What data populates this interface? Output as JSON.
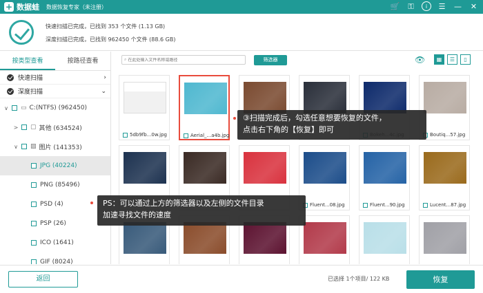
{
  "titlebar": {
    "app_name": "数据蛙",
    "subtitle": "数据恢复专家（未注册）",
    "icons": [
      "cart-icon",
      "key-icon",
      "info-icon",
      "menu-icon",
      "minimize-icon",
      "close-icon"
    ]
  },
  "status": {
    "quick_scan": "快速扫描已完成，已找到 353 个文件 (1.13 GB)",
    "deep_scan": "深度扫描已完成，已找到 962450 个文件 (88.6 GB)"
  },
  "sidebar": {
    "tabs": [
      "按类型查看",
      "按路径查看"
    ],
    "active_tab": 0,
    "quick_scan_label": "快速扫描",
    "deep_scan_label": "深度扫描",
    "tree": [
      {
        "label": "C:(NTFS) (962450)",
        "level": 0,
        "chevron": "∨",
        "icon": "drive-icon"
      },
      {
        "label": "其他 (634524)",
        "level": 1,
        "chevron": ">",
        "icon": "folder-icon"
      },
      {
        "label": "图片 (141353)",
        "level": 1,
        "chevron": "∨",
        "icon": "image-icon"
      },
      {
        "label": "JPG (40224)",
        "level": 2,
        "chevron": "",
        "icon": "",
        "selected": true
      },
      {
        "label": "PNG (85496)",
        "level": 2,
        "chevron": "",
        "icon": ""
      },
      {
        "label": "PSD (4)",
        "level": 2,
        "chevron": "",
        "icon": ""
      },
      {
        "label": "PSP (26)",
        "level": 2,
        "chevron": "",
        "icon": ""
      },
      {
        "label": "ICO (1641)",
        "level": 2,
        "chevron": "",
        "icon": ""
      },
      {
        "label": "GIF (8024)",
        "level": 2,
        "chevron": "",
        "icon": ""
      }
    ]
  },
  "toolbar": {
    "search_placeholder": "在此处输入文件名称或路径",
    "filter_label": "筛选器"
  },
  "files": [
    {
      "name": "5db9fb...0w.jpg",
      "thumb": "screenshot"
    },
    {
      "name": "Aerial_...a4b.jpg",
      "thumb": "#4fb8d0",
      "highlight": true
    },
    {
      "name": "",
      "thumb": "#7a4a30"
    },
    {
      "name": "",
      "thumb": "#2a2f3a"
    },
    {
      "name": "Bokeh...4c.jpg",
      "thumb": "#0d2a6b"
    },
    {
      "name": "Boutiq...57.jpg",
      "thumb": "#b8aca3"
    },
    {
      "name": "",
      "thumb": "#1d3250"
    },
    {
      "name": "",
      "thumb": "#3a2a24"
    },
    {
      "name": "",
      "thumb": "#d9323e"
    },
    {
      "name": "Fluent...08.jpg",
      "thumb": "#1c4d8a"
    },
    {
      "name": "Fluent...90.jpg",
      "thumb": "#2563a6"
    },
    {
      "name": "Lucent...87.jpg",
      "thumb": "#9a6a1c"
    },
    {
      "name": "",
      "thumb": "#385a7a"
    },
    {
      "name": "",
      "thumb": "#8a4c2b"
    },
    {
      "name": "",
      "thumb": "#5c1230"
    },
    {
      "name": "",
      "thumb": "#b23a4a"
    },
    {
      "name": "",
      "thumb": "#b9dfe8"
    },
    {
      "name": "",
      "thumb": "#a0a0a6"
    }
  ],
  "tips": {
    "tip1_line1": "③扫描完成后，勾选任意想要恢复的文件，",
    "tip1_line2": "点击右下角的【恢复】即可",
    "tip2_line1": "PS：可以通过上方的筛选器以及左侧的文件目录",
    "tip2_line2": "加速寻找文件的速度"
  },
  "footer": {
    "back_label": "返回",
    "selected_info": "已选择 1个项目/ 122 KB",
    "recover_label": "恢复"
  },
  "colors": {
    "accent": "#1f9a96",
    "highlight": "#e84b3c"
  }
}
